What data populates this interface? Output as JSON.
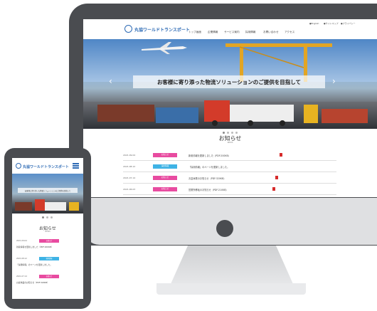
{
  "site": {
    "logo_text": "丸協ワールドトランスポート",
    "utility_links": [
      "●English",
      "●サイトマップ",
      "●プライバシー"
    ],
    "nav": [
      "トップ画面",
      "企業情報",
      "サービス案内",
      "採用情報",
      "お問い合わせ",
      "アクセス"
    ],
    "hero_caption": "お客様に寄り添った物流ソリューションのご提供を目指して",
    "arrow_prev": "‹",
    "arrow_next": "›",
    "news_title": "お知らせ",
    "news_subtitle": "NEWS",
    "news": [
      {
        "date": "2021.09.04",
        "tag": "お知らせ",
        "tag_color": "#e84ba0",
        "text": "新着情報を更新しました（PDF:200KB）",
        "pdf": true
      },
      {
        "date": "2021.08.12",
        "tag": "採用情報",
        "tag_color": "#3fb3e5",
        "text": "「採用情報」のページを更新しました。",
        "pdf": false
      },
      {
        "date": "2021.07.14",
        "tag": "お知らせ",
        "tag_color": "#e84ba0",
        "text": "お盆休業のお知らせ（PDF:320KB）",
        "pdf": true
      },
      {
        "date": "2021.06.03",
        "tag": "お知らせ",
        "tag_color": "#e84ba0",
        "text": "営業所移転のお知らせ（PDF:210KB）",
        "pdf": true
      }
    ]
  },
  "mobile": {
    "logo_text": "丸協ワールドトランスポート",
    "hero_caption": "お客様に寄り添った物流ソリューションのご提供を目指して",
    "news_title": "お知らせ",
    "news_subtitle": "NEWS",
    "news": [
      {
        "date": "2021.09.04",
        "tag": "お知らせ",
        "tag_color": "#e84ba0",
        "text": "新着情報を更新しました（PDF:200KB）"
      },
      {
        "date": "2021.08.12",
        "tag": "採用情報",
        "tag_color": "#3fb3e5",
        "text": "「採用情報」のページを更新しました。"
      },
      {
        "date": "2021.07.14",
        "tag": "お知らせ",
        "tag_color": "#e84ba0",
        "text": "お盆休業のお知らせ（PDF:320KB）"
      }
    ]
  },
  "colors": {
    "brand": "#2e6bb5",
    "tag_news": "#e84ba0",
    "tag_recruit": "#3fb3e5",
    "device": "#4a4c50"
  }
}
